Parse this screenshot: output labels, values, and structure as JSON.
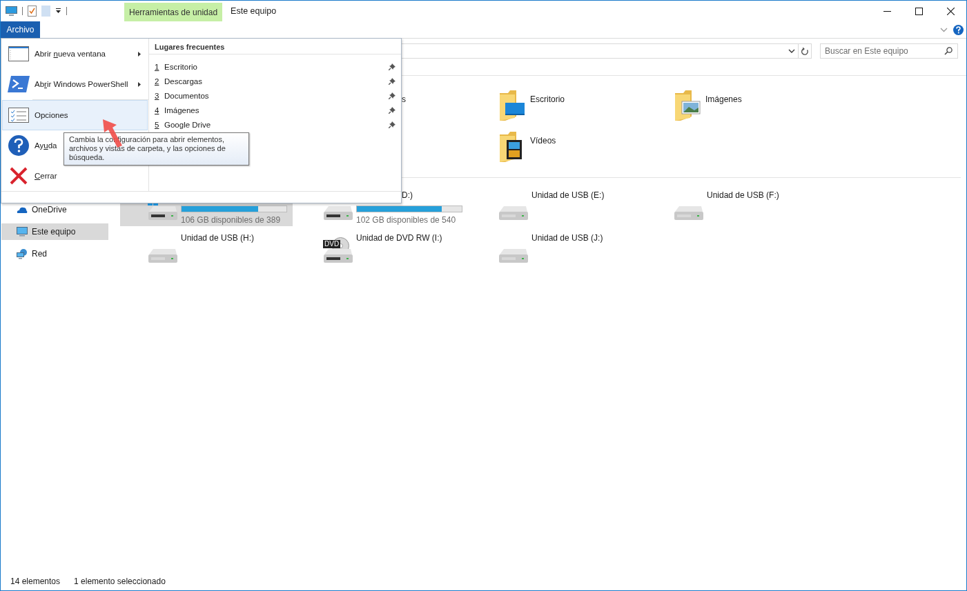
{
  "title_bar": {
    "contextual_tab": "Herramientas de unidad",
    "title": "Este equipo"
  },
  "file_menu": {
    "tab": "Archivo",
    "items": [
      {
        "kind": "window",
        "text_before": "Abrir ",
        "access_key": "n",
        "text_after": "ueva ventana",
        "submenu": true,
        "selected": false
      },
      {
        "kind": "powershell",
        "text_before": "Ab",
        "access_key": "r",
        "text_after": "ir Windows PowerShell",
        "submenu": true,
        "selected": false
      },
      {
        "kind": "options",
        "text_before": "Opciones",
        "submenu": false,
        "selected": true
      },
      {
        "kind": "help",
        "text_before": "Ay",
        "access_key": "u",
        "text_after": "da",
        "submenu": false,
        "selected": false
      },
      {
        "kind": "close",
        "access_key": "C",
        "text_after": "errar",
        "submenu": false,
        "selected": false
      }
    ],
    "frequent": {
      "heading": "Lugares frecuentes",
      "items": [
        {
          "number": "1",
          "label": "Escritorio",
          "pinned": true
        },
        {
          "number": "2",
          "label": "Descargas",
          "pinned": true
        },
        {
          "number": "3",
          "label": "Documentos",
          "pinned": true
        },
        {
          "number": "4",
          "label": "Imágenes",
          "pinned": true
        },
        {
          "number": "5",
          "label": "Google Drive",
          "pinned": true
        }
      ]
    },
    "tooltip": "Cambia la configuración para abrir elementos, archivos y vistas de carpeta, y las opciones de búsqueda."
  },
  "search": {
    "placeholder": "Buscar en Este equipo"
  },
  "sidebar": {
    "items": [
      {
        "kind": "cloud",
        "label": "OneDrive",
        "selected": false
      },
      {
        "kind": "computer",
        "label": "Este equipo",
        "selected": true
      },
      {
        "kind": "network",
        "label": "Red",
        "selected": false
      }
    ]
  },
  "folders": [
    {
      "kind": "covered",
      "label": "s"
    },
    {
      "kind": "desktop",
      "label": "Escritorio"
    },
    {
      "kind": "pictures",
      "label": "Imágenes"
    },
    {
      "kind": "videos",
      "label": "Vídeos"
    }
  ],
  "drives": [
    {
      "kind": "system",
      "level": 0.73,
      "capacity": "106 GB disponibles de 389",
      "selected": true
    },
    {
      "kind": "local",
      "label": "D:)",
      "label_clipped": true,
      "level": 0.81,
      "capacity": "102 GB disponibles de 540",
      "selected": false
    },
    {
      "kind": "usb",
      "label": "Unidad de USB (E:)",
      "selected": false
    },
    {
      "kind": "usb",
      "label": "Unidad de USB (F:)",
      "selected": false
    },
    {
      "kind": "usb",
      "label": "Unidad de USB (H:)",
      "selected": false
    },
    {
      "kind": "dvd",
      "label": "Unidad de DVD RW (I:)",
      "badge": "DVD",
      "selected": false
    },
    {
      "kind": "usb",
      "label": "Unidad de USB (J:)",
      "selected": false
    }
  ],
  "status_bar": {
    "count": "14 elementos",
    "selection": "1 elemento seleccionado"
  }
}
